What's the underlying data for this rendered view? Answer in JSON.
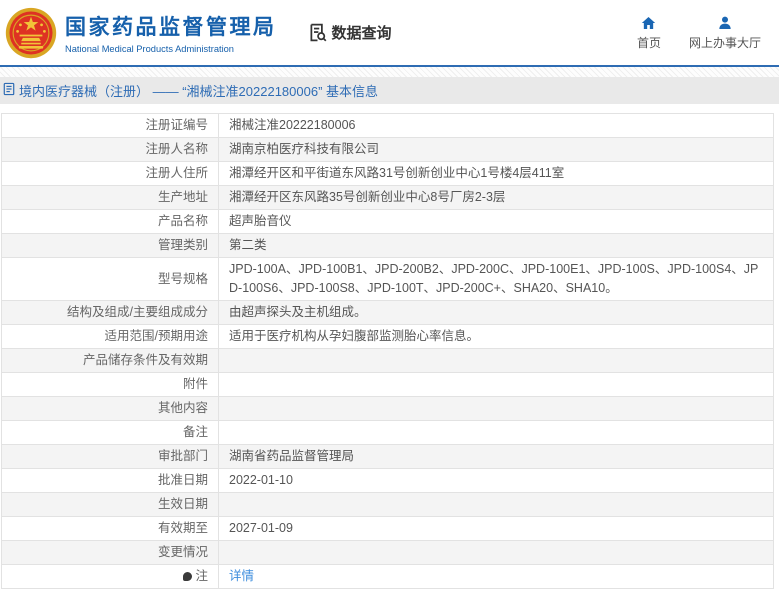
{
  "header": {
    "org_name": "国家药品监督管理局",
    "org_name_en": "National Medical Products Administration",
    "section_title": "数据查询",
    "nav": [
      {
        "icon": "home-icon",
        "label": "首页"
      },
      {
        "icon": "user-icon",
        "label": "网上办事大厅"
      }
    ]
  },
  "breadcrumb": {
    "icon": "document-icon",
    "title": "境内医疗器械（注册） —— “湘械注准20222180006” 基本信息"
  },
  "table": {
    "rows": [
      {
        "label": "注册证编号",
        "value": "湘械注准20222180006"
      },
      {
        "label": "注册人名称",
        "value": "湖南京柏医疗科技有限公司"
      },
      {
        "label": "注册人住所",
        "value": "湘潭经开区和平街道东风路31号创新创业中心1号楼4层411室"
      },
      {
        "label": "生产地址",
        "value": "湘潭经开区东风路35号创新创业中心8号厂房2-3层"
      },
      {
        "label": "产品名称",
        "value": "超声胎音仪"
      },
      {
        "label": "管理类别",
        "value": "第二类"
      },
      {
        "label": "型号规格",
        "value": "JPD-100A、JPD-100B1、JPD-200B2、JPD-200C、JPD-100E1、JPD-100S、JPD-100S4、JPD-100S6、JPD-100S8、JPD-100T、JPD-200C+、SHA20、SHA10。"
      },
      {
        "label": "结构及组成/主要组成成分",
        "value": "由超声探头及主机组成。"
      },
      {
        "label": "适用范围/预期用途",
        "value": "适用于医疗机构从孕妇腹部监测胎心率信息。"
      },
      {
        "label": "产品储存条件及有效期",
        "value": ""
      },
      {
        "label": "附件",
        "value": ""
      },
      {
        "label": "其他内容",
        "value": ""
      },
      {
        "label": "备注",
        "value": ""
      },
      {
        "label": "审批部门",
        "value": "湖南省药品监督管理局"
      },
      {
        "label": "批准日期",
        "value": "2022-01-10"
      },
      {
        "label": "生效日期",
        "value": ""
      },
      {
        "label": "有效期至",
        "value": "2027-01-09"
      },
      {
        "label": "变更情况",
        "value": ""
      },
      {
        "label": "注",
        "label_icon": "note-icon",
        "value": "详情",
        "link": true
      }
    ]
  },
  "colors": {
    "brand_blue": "#1660ab",
    "separator_blue": "#2e6cb3",
    "breadcrumb_text": "#2e6cb5",
    "breadcrumb_bg": "#e9e9e9",
    "alt_row_bg": "#f4f4f4",
    "link_blue": "#3e8ddd",
    "emblem_red": "#de3223",
    "emblem_gold": "#d9a623"
  }
}
